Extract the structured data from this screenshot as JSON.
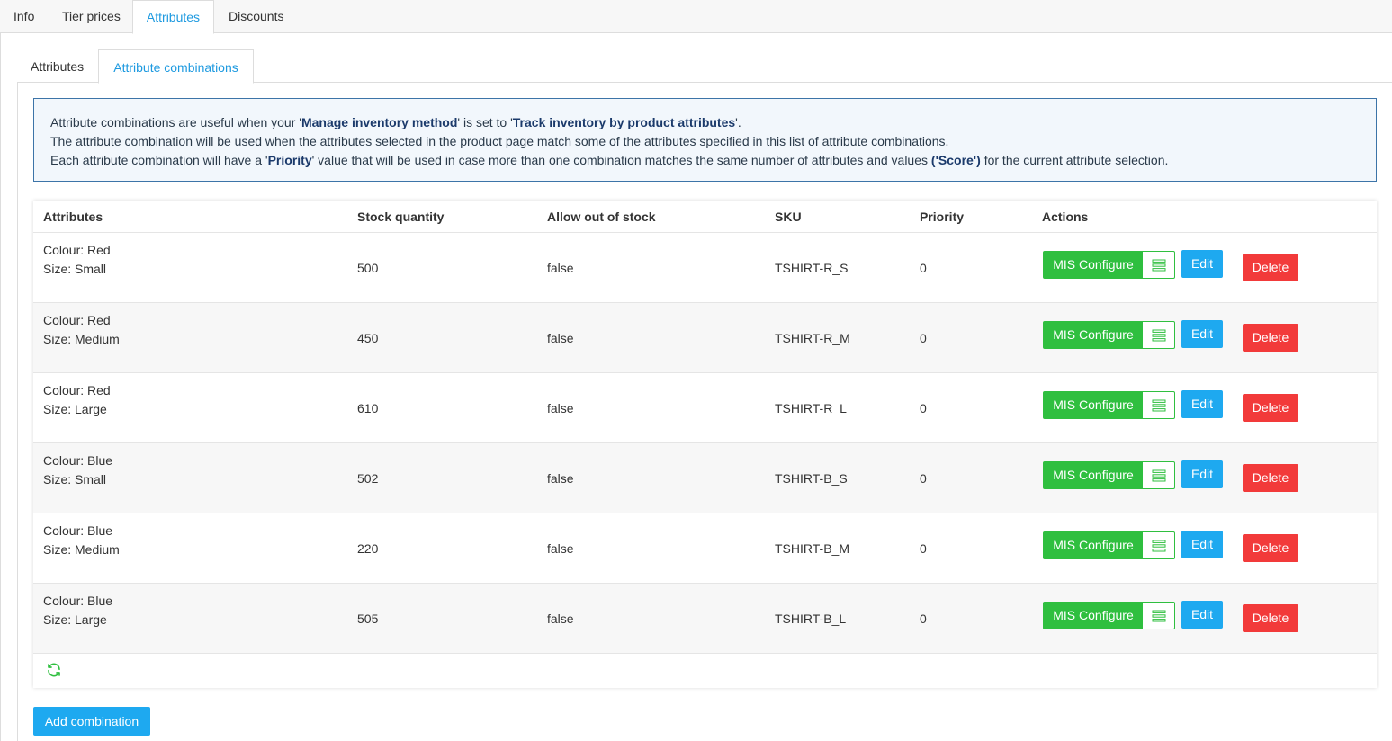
{
  "top_tabs": [
    "Info",
    "Tier prices",
    "Attributes",
    "Discounts"
  ],
  "sub_tabs": [
    "Attributes",
    "Attribute combinations"
  ],
  "info": {
    "l1_a": "Attribute combinations are useful when your '",
    "l1_b": "Manage inventory method",
    "l1_c": "' is set to '",
    "l1_d": "Track inventory by product attributes",
    "l1_e": "'.",
    "l2": "The attribute combination will be used when the attributes selected in the product page match some of the attributes specified in this list of attribute combinations.",
    "l3_a": "Each attribute combination will have a '",
    "l3_b": "Priority",
    "l3_c": "' value that will be used in case more than one combination matches the same number of attributes and values ",
    "l3_d": "('Score')",
    "l3_e": " for the current attribute selection."
  },
  "table": {
    "headers": [
      "Attributes",
      "Stock quantity",
      "Allow out of stock",
      "SKU",
      "Priority",
      "Actions"
    ],
    "rows": [
      {
        "colour": "Colour: Red",
        "size": "Size: Small",
        "stock": "500",
        "oos": "false",
        "sku": "TSHIRT-R_S",
        "priority": "0"
      },
      {
        "colour": "Colour: Red",
        "size": "Size: Medium",
        "stock": "450",
        "oos": "false",
        "sku": "TSHIRT-R_M",
        "priority": "0"
      },
      {
        "colour": "Colour: Red",
        "size": "Size: Large",
        "stock": "610",
        "oos": "false",
        "sku": "TSHIRT-R_L",
        "priority": "0"
      },
      {
        "colour": "Colour: Blue",
        "size": "Size: Small",
        "stock": "502",
        "oos": "false",
        "sku": "TSHIRT-B_S",
        "priority": "0"
      },
      {
        "colour": "Colour: Blue",
        "size": "Size: Medium",
        "stock": "220",
        "oos": "false",
        "sku": "TSHIRT-B_M",
        "priority": "0"
      },
      {
        "colour": "Colour: Blue",
        "size": "Size: Large",
        "stock": "505",
        "oos": "false",
        "sku": "TSHIRT-B_L",
        "priority": "0"
      }
    ],
    "actions": {
      "mis": "MIS Configure",
      "edit": "Edit",
      "delete": "Delete"
    }
  },
  "add_button": "Add combination",
  "icons": {
    "refresh": "refresh-icon",
    "list": "list-icon"
  },
  "colors": {
    "accent": "#1e9ae0",
    "green": "#2fbf3f",
    "blue_btn": "#1ea9f0",
    "red_btn": "#f23a3a"
  }
}
